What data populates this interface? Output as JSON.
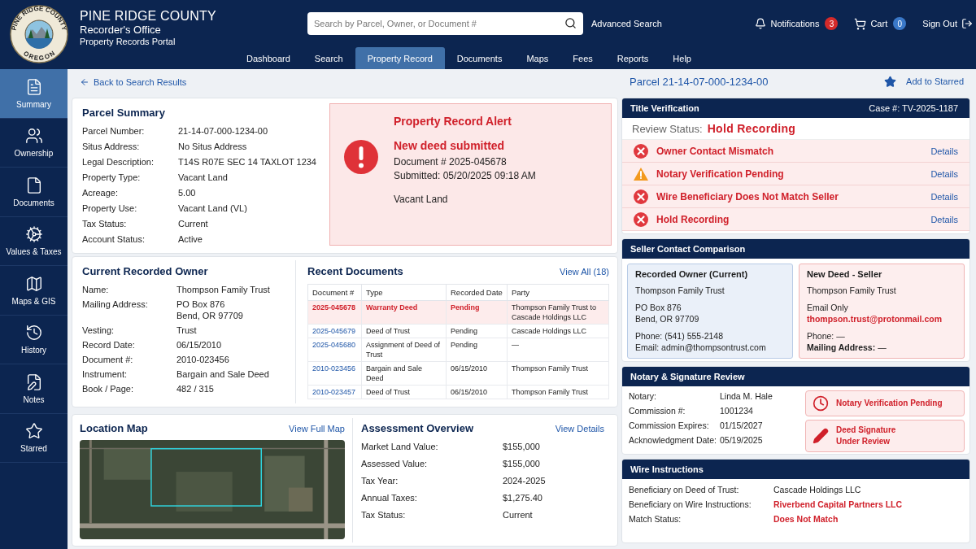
{
  "logo": {
    "top": "PINE RIDGE COUNTY",
    "bottom": "OREGON"
  },
  "header": {
    "title": "PINE RIDGE COUNTY",
    "subtitle": "Recorder's Office",
    "tagline": "Property Records Portal"
  },
  "search": {
    "placeholder": "Search by Parcel, Owner, or Document #"
  },
  "advanced_search": "Advanced Search",
  "notifications": {
    "label": "Notifications",
    "count": "3"
  },
  "cart": {
    "label": "Cart",
    "count": "0"
  },
  "sign_out": "Sign Out",
  "nav": [
    {
      "label": "Dashboard",
      "selected": false
    },
    {
      "label": "Search",
      "selected": false
    },
    {
      "label": "Property Record",
      "selected": true
    },
    {
      "label": "Documents",
      "selected": false
    },
    {
      "label": "Maps",
      "selected": false
    },
    {
      "label": "Fees",
      "selected": false
    },
    {
      "label": "Reports",
      "selected": false
    },
    {
      "label": "Help",
      "selected": false
    }
  ],
  "sidebar": {
    "items": [
      {
        "kind": "summary",
        "label": "Summary",
        "selected": true
      },
      {
        "kind": "ownership",
        "label": "Ownership",
        "selected": false
      },
      {
        "kind": "documents",
        "label": "Documents",
        "selected": false
      },
      {
        "kind": "values",
        "label": "Values & Taxes",
        "selected": false
      },
      {
        "kind": "maps",
        "label": "Maps & GIS",
        "selected": false
      },
      {
        "kind": "history",
        "label": "History",
        "selected": false
      },
      {
        "kind": "notes",
        "label": "Notes",
        "selected": false
      },
      {
        "kind": "starred",
        "label": "Starred",
        "selected": false
      }
    ]
  },
  "back_link": "Back to Search Results",
  "parcel_summary": {
    "title": "Parcel Summary",
    "fields": [
      {
        "label": "Parcel Number:",
        "value": "21-14-07-000-1234-00"
      },
      {
        "label": "Situs Address:",
        "value": "No Situs Address"
      },
      {
        "label": "Legal Description:",
        "value": "T14S R07E SEC 14 TAXLOT 1234"
      },
      {
        "label": "Property Type:",
        "value": "Vacant Land"
      },
      {
        "label": "Acreage:",
        "value": "5.00"
      },
      {
        "label": "Property Use:",
        "value": "Vacant Land (VL)"
      },
      {
        "label": "Tax Status:",
        "value": "Current"
      },
      {
        "label": "Account Status:",
        "value": "Active"
      }
    ]
  },
  "alert": {
    "title": "Property Record Alert",
    "heading": "New deed submitted",
    "document": "Document # 2025-045678",
    "submitted": "Submitted: 05/20/2025 09:18 AM",
    "note": "Vacant Land"
  },
  "owner": {
    "title": "Current Recorded Owner",
    "fields": [
      {
        "label": "Name:",
        "lines": [
          "Thompson Family Trust"
        ]
      },
      {
        "label": "Mailing Address:",
        "lines": [
          "PO Box 876",
          "Bend, OR  97709"
        ]
      },
      {
        "label": "Vesting:",
        "lines": [
          "Trust"
        ]
      },
      {
        "label": "Record Date:",
        "lines": [
          "06/15/2010"
        ]
      },
      {
        "label": "Document #:",
        "lines": [
          "2010-023456"
        ]
      },
      {
        "label": "Instrument:",
        "lines": [
          "Bargain and Sale Deed"
        ]
      },
      {
        "label": "Book / Page:",
        "lines": [
          "482  / 315"
        ]
      }
    ]
  },
  "recent_documents": {
    "title": "Recent Documents",
    "view_all": "View All (18)",
    "columns": [
      "Document #",
      "Type",
      "Recorded Date",
      "Party"
    ],
    "rows": [
      {
        "flagged": true,
        "cells": [
          "2025-045678",
          "Warranty Deed",
          "Pending",
          "Thompson Family Trust to Cascade Holdings LLC"
        ]
      },
      {
        "flagged": false,
        "cells": [
          "2025-045679",
          "Deed of Trust",
          "Pending",
          "Cascade Holdings LLC"
        ]
      },
      {
        "flagged": false,
        "cells": [
          "2025-045680",
          "Assignment of Deed of Trust",
          "Pending",
          "—"
        ]
      },
      {
        "flagged": false,
        "cells": [
          "2010-023456",
          "Bargain and Sale Deed",
          "06/15/2010",
          "Thompson Family Trust"
        ]
      },
      {
        "flagged": false,
        "cells": [
          "2010-023457",
          "Deed of Trust",
          "06/15/2010",
          "Thompson Family Trust"
        ]
      }
    ]
  },
  "location_map": {
    "title": "Location Map",
    "link": "View Full Map"
  },
  "assessment": {
    "title": "Assessment Overview",
    "link": "View Details",
    "fields": [
      {
        "label": "Market Land Value:",
        "value": "$155,000"
      },
      {
        "label": "Assessed Value:",
        "value": "$155,000"
      },
      {
        "label": "Tax Year:",
        "value": "2024-2025"
      },
      {
        "label": "Annual Taxes:",
        "value": "$1,275.40"
      },
      {
        "label": "Tax Status:",
        "value": "Current"
      }
    ]
  },
  "parcel_heading": "Parcel 21-14-07-000-1234-00",
  "add_starred": "Add to Starred",
  "title_verification": {
    "title": "Title Verification",
    "case": "Case #: TV-2025-1187",
    "status_label": "Review Status:",
    "status": "Hold Recording",
    "checks": [
      {
        "kind": "error",
        "label": "Owner Contact Mismatch",
        "link": "Details"
      },
      {
        "kind": "warning",
        "label": "Notary Verification Pending",
        "link": "Details"
      },
      {
        "kind": "error",
        "label": "Wire Beneficiary Does Not Match Seller",
        "link": "Details"
      },
      {
        "kind": "error",
        "label": "Hold Recording",
        "link": "Details"
      }
    ]
  },
  "seller_contact": {
    "title": "Seller Contact Comparison",
    "cards": [
      {
        "kind": "current",
        "title": "Recorded Owner (Current)",
        "groups": [
          [
            {
              "text": "Thompson Family Trust",
              "flagged": false
            }
          ],
          [
            {
              "text": "PO Box 876",
              "flagged": false
            },
            {
              "text": "Bend, OR 97709",
              "flagged": false
            }
          ],
          [
            {
              "text": "Phone:  (541) 555-2148",
              "flagged": false
            },
            {
              "text": "Email:  admin@thompsontrust.com",
              "flagged": false
            }
          ]
        ]
      },
      {
        "kind": "new",
        "title": "New Deed - Seller",
        "groups": [
          [
            {
              "text": "Thompson Family Trust",
              "flagged": false
            }
          ],
          [
            {
              "text": "Email Only",
              "flagged": false
            },
            {
              "text": "thompson.trust@protonmail.com",
              "flagged": true
            }
          ],
          [
            {
              "text": "Phone:  —",
              "flagged": false
            },
            {
              "text": "**Mailing Address:**  —",
              "flagged": false
            }
          ]
        ]
      }
    ]
  },
  "notary": {
    "title": "Notary & Signature Review",
    "fields": [
      {
        "label": "Notary:",
        "value": "Linda M. Hale"
      },
      {
        "label": "Commission #:",
        "value": "1001234"
      },
      {
        "label": "Commission Expires:",
        "value": "01/15/2027"
      },
      {
        "label": "Acknowledgment Date:",
        "value": "05/19/2025"
      }
    ],
    "badges": [
      {
        "kind": "clock",
        "lines": [
          "Notary Verification Pending"
        ]
      },
      {
        "kind": "pen",
        "lines": [
          "Deed Signature",
          "Under Review"
        ]
      }
    ]
  },
  "wire": {
    "title": "Wire Instructions",
    "fields": [
      {
        "label": "Beneficiary on Deed of Trust:",
        "value": "Cascade Holdings LLC",
        "flagged": false
      },
      {
        "label": "Beneficiary on Wire Instructions:",
        "value": "Riverbend Capital Partners LLC",
        "flagged": true
      },
      {
        "label": "Match Status:",
        "value": "Does Not Match",
        "flagged": true
      }
    ]
  }
}
